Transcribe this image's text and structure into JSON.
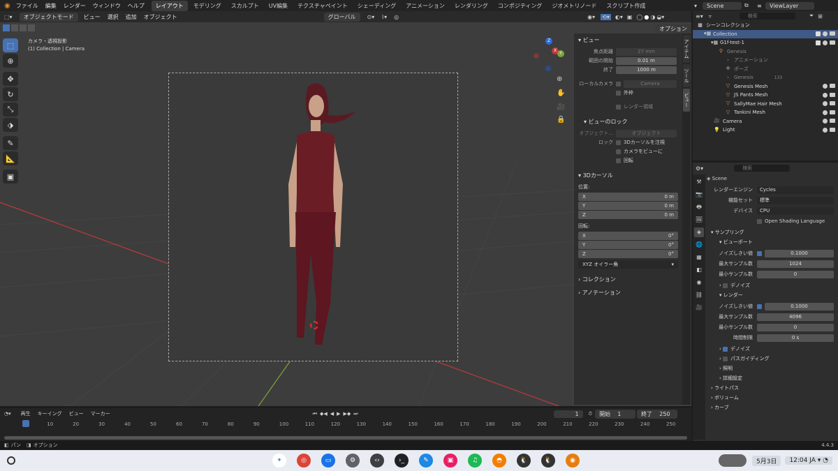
{
  "menus": [
    "ファイル",
    "編集",
    "レンダー",
    "ウィンドウ",
    "ヘルプ"
  ],
  "workspaces": [
    "レイアウト",
    "モデリング",
    "スカルプト",
    "UV編集",
    "テクスチャペイント",
    "シェーディング",
    "アニメーション",
    "レンダリング",
    "コンポジティング",
    "ジオメトリノード",
    "スクリプト作成"
  ],
  "scene_name": "Scene",
  "view_layer": "ViewLayer",
  "header": {
    "mode": "オブジェクトモード",
    "view": "ビュー",
    "select": "選択",
    "add": "追加",
    "object": "オブジェクト",
    "orientation": "グローバル",
    "options": "オプション"
  },
  "viewport": {
    "title": "カメラ・透視投影",
    "subtitle": "(1) Collection | Camera"
  },
  "npanel": {
    "view_title": "ビュー",
    "focal_label": "焦点距離",
    "focal_value": "27 mm",
    "clip_start_label": "範囲の開始",
    "clip_start_value": "0.01 m",
    "clip_end_label": "終了",
    "clip_end_value": "1000 m",
    "local_camera_label": "ローカルカメラ",
    "local_camera_value": "Camera",
    "border_label": "外枠",
    "render_region_label": "レンダー領域",
    "view_lock_title": "ビューのロック",
    "object_label": "オブジェクト...",
    "object_value": "オブジェクト",
    "lock_label": "ロック",
    "lock_3dcursor": "3Dカーソルを注視",
    "lock_cam": "カメラをビューに",
    "lock_rot": "回転",
    "cursor_title": "3Dカーソル",
    "position_label": "位置:",
    "pos": [
      {
        "axis": "X",
        "val": "0 m"
      },
      {
        "axis": "Y",
        "val": "0 m"
      },
      {
        "axis": "Z",
        "val": "0 m"
      }
    ],
    "rotation_label": "回転:",
    "rot": [
      {
        "axis": "X",
        "val": "0°"
      },
      {
        "axis": "Y",
        "val": "0°"
      },
      {
        "axis": "Z",
        "val": "0°"
      }
    ],
    "euler": "XYZ オイラー角",
    "collection": "コレクション",
    "annotation": "アノテーション",
    "tabs": [
      "アイテム",
      "ツール",
      "ビュー"
    ]
  },
  "outliner": {
    "search_placeholder": "検索",
    "rows": [
      {
        "label": "シーンコレクション",
        "indent": 0,
        "sel": false
      },
      {
        "label": "Collection",
        "indent": 1,
        "sel": true
      },
      {
        "label": "G1f-test-1",
        "indent": 2,
        "sel": false
      },
      {
        "label": "Genesis",
        "indent": 3,
        "sel": false
      },
      {
        "label": "アニメーション",
        "indent": 4,
        "sel": false
      },
      {
        "label": "ポーズ",
        "indent": 4,
        "sel": false
      },
      {
        "label": "Genesis",
        "indent": 4,
        "sel": false
      },
      {
        "label": "Genesis Mesh",
        "indent": 4,
        "sel": false
      },
      {
        "label": "JS Pants Mesh",
        "indent": 4,
        "sel": false
      },
      {
        "label": "SallyMae Hair Mesh",
        "indent": 4,
        "sel": false
      },
      {
        "label": "Tankini Mesh",
        "indent": 4,
        "sel": false
      },
      {
        "label": "Camera",
        "indent": 2,
        "sel": false
      },
      {
        "label": "Light",
        "indent": 2,
        "sel": false
      }
    ],
    "badge": "133"
  },
  "props": {
    "search_placeholder": "検索",
    "scene": "Scene",
    "render_engine_label": "レンダーエンジン",
    "render_engine": "Cycles",
    "feature_set_label": "機能セット",
    "feature_set": "標準",
    "device_label": "デバイス",
    "device": "CPU",
    "osl": "Open Shading Language",
    "sampling": "サンプリング",
    "viewport": "ビューポート",
    "noise_label": "ノイズしきい値",
    "vp_noise": "0.1000",
    "max_samples_label": "最大サンプル数",
    "vp_max": "1024",
    "min_samples_label": "最小サンプル数",
    "vp_min": "0",
    "denoise": "デノイズ",
    "render": "レンダー",
    "r_noise": "0.1000",
    "r_max": "4096",
    "r_min": "0",
    "time_limit_label": "時間制限",
    "time_limit": "0 s",
    "path_guiding": "パスガイディング",
    "lights": "照明",
    "advanced": "詳細設定",
    "light_paths": "ライトパス",
    "volumes": "ボリューム",
    "curves": "カーブ"
  },
  "timeline": {
    "play": "再生",
    "keying": "キーイング",
    "view": "ビュー",
    "marker": "マーカー",
    "current": "1",
    "start_label": "開始",
    "start": "1",
    "end_label": "終了",
    "end": "250",
    "ticks": [
      "1",
      "10",
      "20",
      "30",
      "40",
      "50",
      "60",
      "70",
      "80",
      "90",
      "100",
      "110",
      "120",
      "130",
      "140",
      "150",
      "160",
      "170",
      "180",
      "190",
      "200",
      "210",
      "220",
      "230",
      "240",
      "250"
    ]
  },
  "status": {
    "pan": "パン",
    "options": "オプション",
    "version": "4.4.3"
  },
  "taskbar": {
    "date": "5月3日",
    "time": "12:04",
    "lang": "JA"
  },
  "colors": {
    "accent": "#4772b3",
    "selected": "#3f5a86",
    "xaxis": "#c0393c",
    "yaxis": "#7ea53b"
  }
}
